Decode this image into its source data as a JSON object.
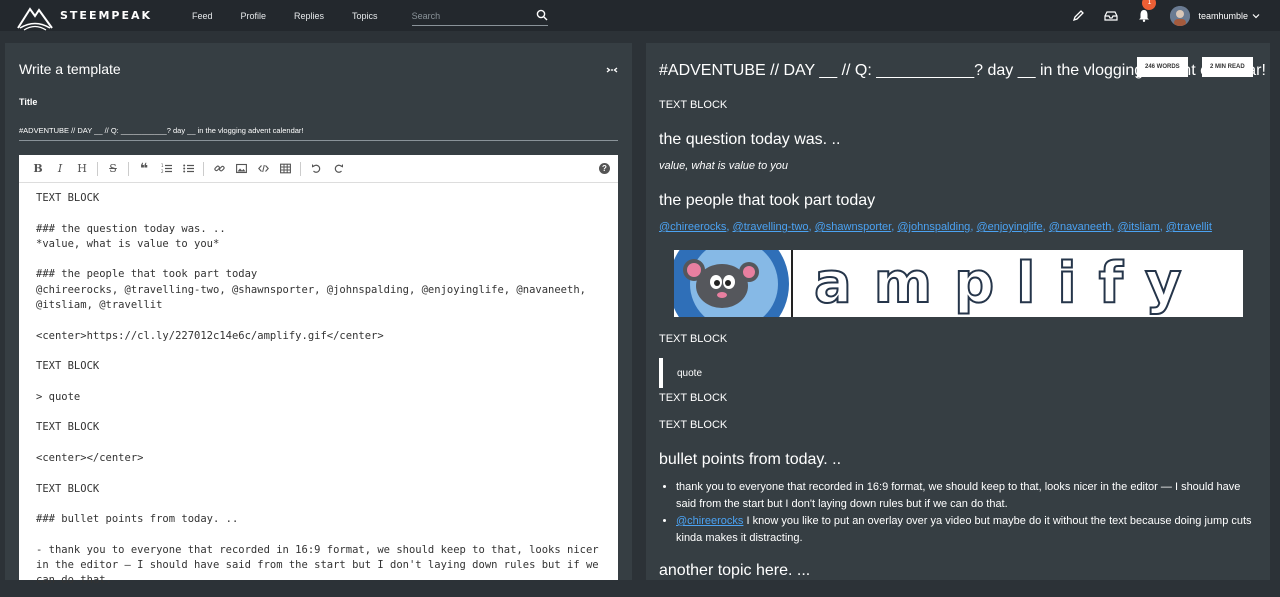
{
  "brand": {
    "name": "STEEMPEAK"
  },
  "nav": {
    "items": [
      "Feed",
      "Profile",
      "Replies",
      "Topics"
    ],
    "search_placeholder": "Search"
  },
  "user": {
    "name": "teamhumble",
    "notifications": "1"
  },
  "editor": {
    "panel_title": "Write a template",
    "title_label": "Title",
    "title_value": "#ADVENTUBE // DAY __ // Q: ___________? day __ in the vlogging advent calendar!",
    "toolbar": [
      "bold-icon",
      "italic-icon",
      "heading-icon",
      "strikethrough-icon",
      "quote-icon",
      "ordered-list-icon",
      "unordered-list-icon",
      "link-icon",
      "image-icon",
      "code-icon",
      "table-icon",
      "undo-icon",
      "redo-icon",
      "help-icon"
    ],
    "markdown": "TEXT BLOCK\n\n### the question today was. ..\n*value, what is value to you*\n\n### the people that took part today\n@chireerocks, @travelling-two, @shawnsporter, @johnspalding, @enjoyinglife, @navaneeth, @itsliam, @travellit\n\n<center>https://cl.ly/227012c14e6c/amplify.gif</center>\n\nTEXT BLOCK\n\n> quote\n\nTEXT BLOCK\n\n<center></center>\n\nTEXT BLOCK\n\n### bullet points from today. ..\n\n- thank you to everyone that recorded in 16:9 format, we should keep to that, looks nicer in the editor — I should have said from the start but I don't laying down rules but if we can do that."
  },
  "preview": {
    "title": "#ADVENTUBE // DAY __ // Q: ___________? day __ in the vlogging advent calendar!",
    "words": "246 WORDS",
    "read_time": "2 MIN READ",
    "text_block": "TEXT BLOCK",
    "h_question": "the question today was. ..",
    "question_answer": "value, what is value to you",
    "h_people": "the people that took part today",
    "people": [
      "@chireerocks",
      "@travelling-two",
      "@shawnsporter",
      "@johnspalding",
      "@enjoyinglife",
      "@navaneeth",
      "@itsliam",
      "@travellit"
    ],
    "amplify_text": "amplify",
    "quote": "quote",
    "h_bullets": "bullet points from today. ..",
    "bullet1": "thank you to everyone that recorded in 16:9 format, we should keep to that, looks nicer in the editor — I should have said from the start but I don't laying down rules but if we can do that.",
    "bullet2_link": "@chireerocks",
    "bullet2_text": " I know you like to put an overlay over ya video but maybe do it without the text because doing jump cuts kinda makes it distracting.",
    "h_another": "another topic here. ..."
  }
}
